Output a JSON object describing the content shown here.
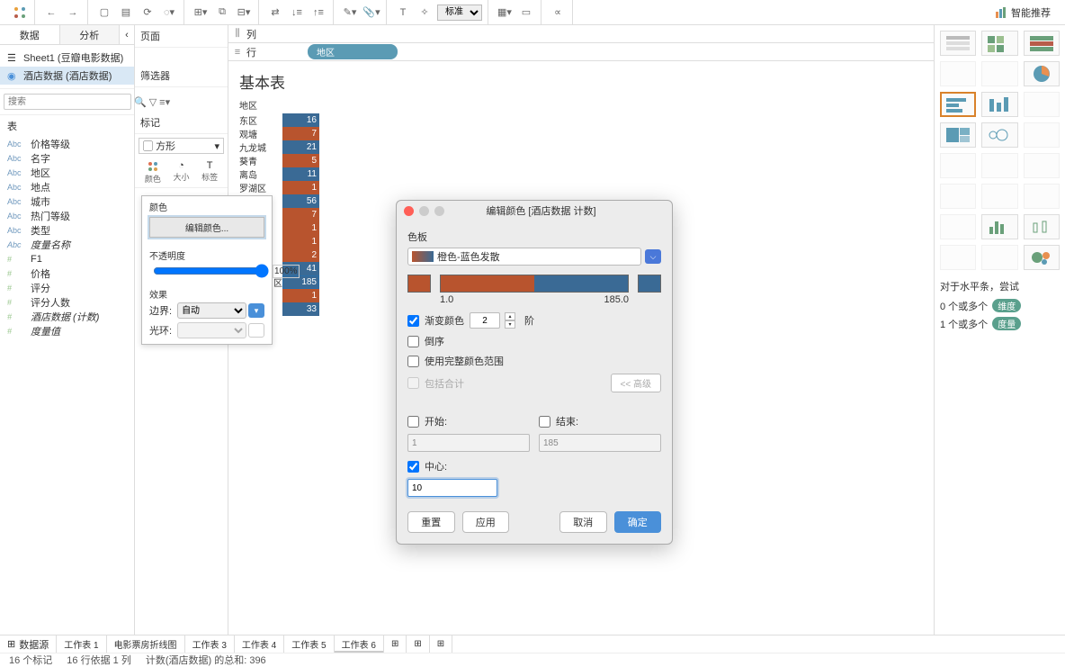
{
  "toolbar": {
    "standard_label": "标准",
    "smart_rec": "智能推荐"
  },
  "left": {
    "tab_data": "数据",
    "tab_analysis": "分析",
    "sources": [
      {
        "label": "Sheet1 (豆瓣电影数据)"
      },
      {
        "label": "酒店数据 (酒店数据)"
      }
    ],
    "search_placeholder": "搜索",
    "table_label": "表",
    "fields_dim": [
      "价格等级",
      "名字",
      "地区",
      "地点",
      "城市",
      "热门等级",
      "类型",
      "度量名称"
    ],
    "fields_measure": [
      "F1",
      "价格",
      "评分",
      "评分人数",
      "酒店数据 (计数)",
      "度量值"
    ]
  },
  "mid": {
    "pages_label": "页面",
    "filters_label": "筛选器",
    "marks_label": "标记",
    "mark_type": "方形",
    "mark_color": "颜色",
    "mark_size": "大小",
    "mark_label": "标签"
  },
  "color_popup": {
    "color_label": "颜色",
    "edit_btn": "编辑颜色...",
    "opacity_label": "不透明度",
    "opacity_val": "100%",
    "effects_label": "效果",
    "border_label": "边界:",
    "border_val": "自动",
    "halo_label": "光环:"
  },
  "shelves": {
    "cols_label": "列",
    "rows_label": "行",
    "rows_pill": "地区"
  },
  "viz": {
    "title": "基本表",
    "col_header": "地区",
    "rows_visible": [
      {
        "label": "东区",
        "value": 16
      },
      {
        "label": "观塘",
        "value": 7
      },
      {
        "label": "九龙城",
        "value": 21
      },
      {
        "label": "葵青",
        "value": 5
      },
      {
        "label": "离岛",
        "value": 11
      },
      {
        "label": "罗湖区",
        "value": 1
      }
    ],
    "rows_after": [
      {
        "value": 56
      },
      {
        "value": 7
      },
      {
        "value": 1
      },
      {
        "value": 1
      },
      {
        "value": 2
      },
      {
        "value": 41
      },
      {
        "value": 185
      },
      {
        "value": 1
      },
      {
        "value": 33
      }
    ],
    "highlight_last": "区"
  },
  "dialog": {
    "title": "编辑颜色 [酒店数据 计数]",
    "palette_label": "色板",
    "palette_name": "橙色-蓝色发散",
    "min": "1.0",
    "max": "185.0",
    "gradient_check": "渐变颜色",
    "steps_val": "2",
    "steps_suffix": "阶",
    "reverse_check": "倒序",
    "fullrange_check": "使用完整颜色范围",
    "include_totals": "包括合计",
    "adv_btn": "<<  高级",
    "start_label": "开始:",
    "end_label": "结束:",
    "start_val": "1",
    "end_val": "185",
    "center_label": "中心:",
    "center_val": "10",
    "btn_reset": "重置",
    "btn_apply": "应用",
    "btn_cancel": "取消",
    "btn_ok": "确定"
  },
  "right": {
    "rec_title": "对于水平条，尝试",
    "rec_line1_pre": "0 个或多个",
    "rec_line1_badge": "维度",
    "rec_line2_pre": "1 个或多个",
    "rec_line2_badge": "度量"
  },
  "bottom": {
    "datasource_tab": "数据源",
    "tabs": [
      "工作表 1",
      "电影票房折线图",
      "工作表 3",
      "工作表 4",
      "工作表 5",
      "工作表 6"
    ],
    "status_marks": "16 个标记",
    "status_rows": "16 行依据 1 列",
    "status_sum": "计数(酒店数据) 的总和: 396"
  },
  "chart_data": {
    "type": "table",
    "title": "基本表",
    "column": "地区",
    "color_measure": "酒店数据 计数",
    "color_scale": {
      "min": 1.0,
      "max": 185.0,
      "palette": "橙色-蓝色发散",
      "center": 10,
      "steps": 2
    },
    "cells": [
      {
        "category": "东区",
        "value": 16
      },
      {
        "category": "观塘",
        "value": 7
      },
      {
        "category": "九龙城",
        "value": 21
      },
      {
        "category": "葵青",
        "value": 5
      },
      {
        "category": "离岛",
        "value": 11
      },
      {
        "category": "罗湖区",
        "value": 1
      },
      {
        "category": null,
        "value": 56
      },
      {
        "category": null,
        "value": 7
      },
      {
        "category": null,
        "value": 1
      },
      {
        "category": null,
        "value": 1
      },
      {
        "category": null,
        "value": 2
      },
      {
        "category": null,
        "value": 41
      },
      {
        "category": null,
        "value": 185
      },
      {
        "category": null,
        "value": 1
      },
      {
        "category": null,
        "value": 33
      }
    ],
    "total_marks": 16,
    "total_sum": 396
  }
}
